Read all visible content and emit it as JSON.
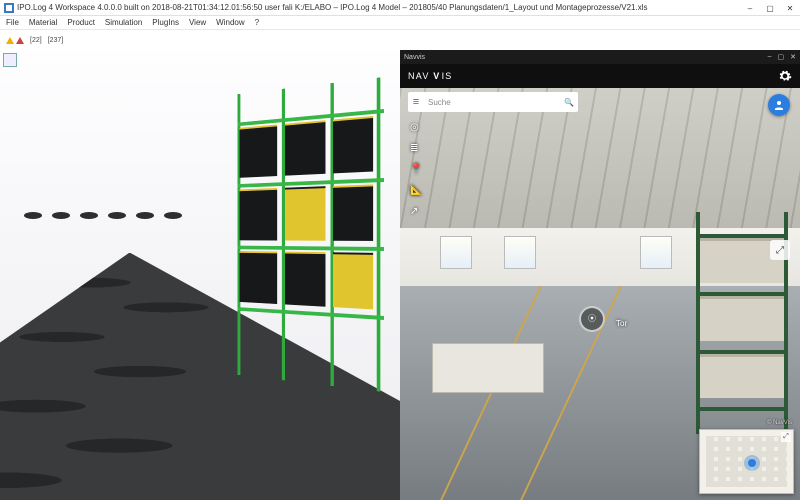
{
  "titlebar": {
    "text": "IPO.Log 4 Workspace 4.0.0.0 built on 2018-08-21T01:34:12.01:56:50 user fali K:/ELABO – IPO.Log 4 Model – 201805/40 Planungsdaten/1_Layout und Montageprozesse/V21.xls"
  },
  "window_controls": {
    "min": "–",
    "max": "▢",
    "close": "✕"
  },
  "menu": [
    "File",
    "Material",
    "Product",
    "Simulation",
    "PlugIns",
    "View",
    "Window",
    "?"
  ],
  "toolbar": {
    "warnings": "[22]",
    "messages": "[237]"
  },
  "navvis": {
    "panel_title": "Navvis",
    "logo": "NAVVIS",
    "search_placeholder": "Suche",
    "tools": {
      "compass": "compass-icon",
      "layers": "layers-icon",
      "pin": "pin-icon",
      "measure": "ruler-icon",
      "share": "share-icon"
    },
    "poi_label": "Tor",
    "attribution": "© NavVis"
  }
}
